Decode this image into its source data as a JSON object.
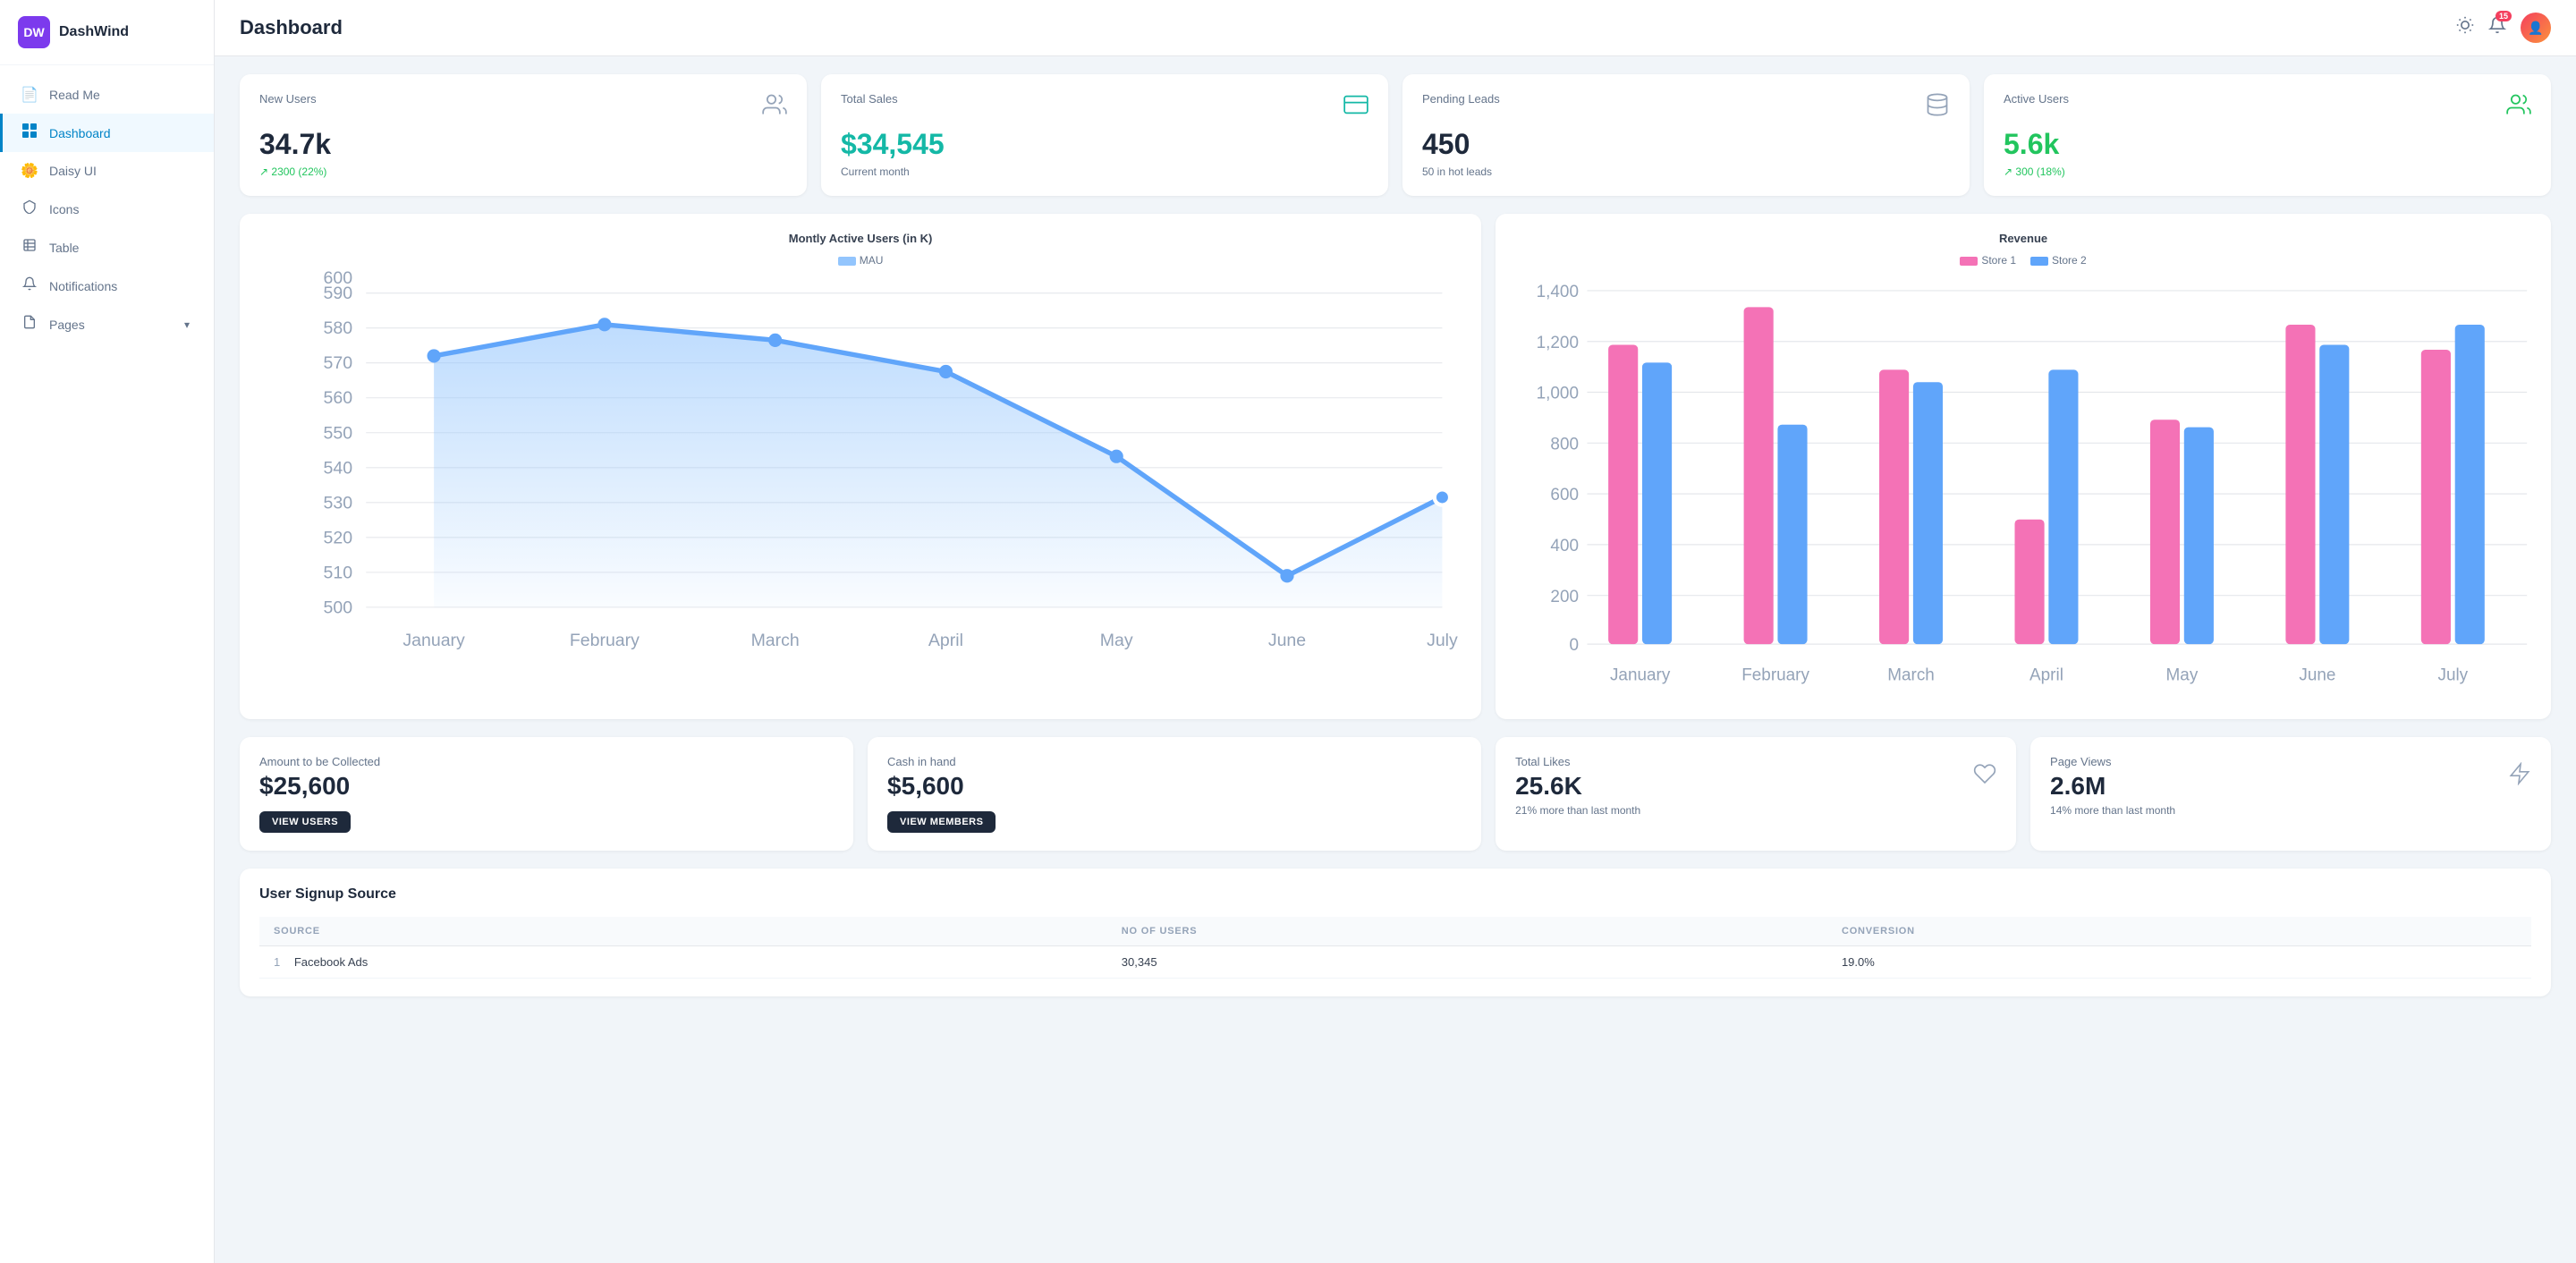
{
  "app": {
    "logo_initials": "DW",
    "logo_name": "DashWind"
  },
  "topbar": {
    "title": "Dashboard",
    "badge_count": "15"
  },
  "sidebar": {
    "items": [
      {
        "id": "read-me",
        "label": "Read Me",
        "icon": "📄",
        "active": false
      },
      {
        "id": "dashboard",
        "label": "Dashboard",
        "icon": "⊞",
        "active": true
      },
      {
        "id": "daisy-ui",
        "label": "Daisy UI",
        "icon": "🌼",
        "active": false
      },
      {
        "id": "icons",
        "label": "Icons",
        "icon": "🛡",
        "active": false
      },
      {
        "id": "table",
        "label": "Table",
        "icon": "📋",
        "active": false
      },
      {
        "id": "notifications",
        "label": "Notifications",
        "icon": "🔔",
        "active": false
      },
      {
        "id": "pages",
        "label": "Pages",
        "icon": "📃",
        "active": false,
        "chevron": true
      }
    ]
  },
  "stat_cards": [
    {
      "label": "New Users",
      "value": "34.7k",
      "sub": "↗ 2300 (22%)",
      "icon": "👥",
      "color": "default"
    },
    {
      "label": "Total Sales",
      "value": "$34,545",
      "sub": "Current month",
      "icon": "💳",
      "color": "teal"
    },
    {
      "label": "Pending Leads",
      "value": "450",
      "sub": "50 in hot leads",
      "icon": "🗄",
      "color": "default"
    },
    {
      "label": "Active Users",
      "value": "5.6k",
      "sub": "↗ 300 (18%)",
      "icon": "👥",
      "color": "green"
    }
  ],
  "mau_chart": {
    "title": "Montly Active Users (in K)",
    "legend": "MAU",
    "months": [
      "January",
      "February",
      "March",
      "April",
      "May",
      "June",
      "July"
    ],
    "values": [
      580,
      590,
      585,
      575,
      548,
      510,
      535
    ],
    "y_labels": [
      500,
      510,
      520,
      530,
      540,
      550,
      560,
      570,
      580,
      590,
      600
    ]
  },
  "revenue_chart": {
    "title": "Revenue",
    "legend": [
      "Store 1",
      "Store 2"
    ],
    "months": [
      "January",
      "February",
      "March",
      "April",
      "May",
      "June",
      "July"
    ],
    "store1": [
      1200,
      1350,
      1100,
      500,
      900,
      1280,
      1180
    ],
    "store2": [
      1130,
      880,
      1050,
      1100,
      870,
      1200,
      1280
    ]
  },
  "bottom_cards": [
    {
      "label": "Amount to be Collected",
      "value": "$25,600",
      "btn": "VIEW USERS"
    },
    {
      "label": "Cash in hand",
      "value": "$5,600",
      "btn": "VIEW MEMBERS"
    },
    {
      "label": "Total Likes",
      "value": "25.6K",
      "sub": "21% more than last month",
      "icon": "♡"
    },
    {
      "label": "Page Views",
      "value": "2.6M",
      "sub": "14% more than last month",
      "icon": "⚡"
    }
  ],
  "signup_table": {
    "title": "User Signup Source",
    "columns": [
      "SOURCE",
      "NO OF USERS",
      "CONVERSION"
    ],
    "rows": [
      {
        "num": "1",
        "source": "Facebook Ads",
        "users": "30,345",
        "conversion": "19.0%"
      }
    ]
  }
}
